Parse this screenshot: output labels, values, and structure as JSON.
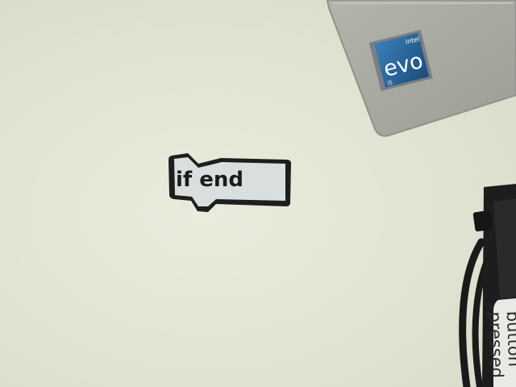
{
  "coding_block": {
    "text": "if end"
  },
  "laptop_badge": {
    "brand": "intel",
    "logo": "evo",
    "tier": "i5"
  },
  "partial_card": {
    "lines": [
      "button",
      "pressed"
    ]
  },
  "colors": {
    "background": "#e4e7d6",
    "laptop": "#a8aaa2",
    "block_fill": "#d9dedf",
    "block_outline": "#1e1e1e",
    "badge_blue": "#2a5f8f"
  }
}
